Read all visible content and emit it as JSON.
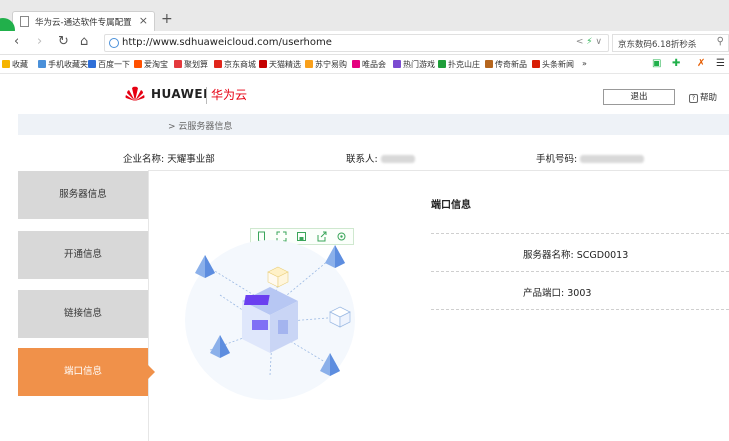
{
  "browser": {
    "tab_title": "华为云-通达软件专属配置",
    "tab_close": "×",
    "new_tab": "+",
    "url": "http://www.sdhuaweicloud.com/userhome",
    "search_text": "京东数码6.18折秒杀",
    "bookmarks": [
      {
        "label": "收藏",
        "color": "#f5b400"
      },
      {
        "label": "手机收藏夹",
        "color": "#4a90d9"
      },
      {
        "label": "百度一下",
        "color": "#2e6fd8"
      },
      {
        "label": "爱淘宝",
        "color": "#ff5000"
      },
      {
        "label": "聚划算",
        "color": "#e4393c"
      },
      {
        "label": "京东商城",
        "color": "#e1251b"
      },
      {
        "label": "天猫精选",
        "color": "#c40000"
      },
      {
        "label": "苏宁易购",
        "color": "#f9a01b"
      },
      {
        "label": "唯品会",
        "color": "#e5007f"
      },
      {
        "label": "热门游戏",
        "color": "#7b4bd1"
      },
      {
        "label": "扑克山庄",
        "color": "#1f9e3a"
      },
      {
        "label": "传奇新品",
        "color": "#b5651d"
      },
      {
        "label": "头条新闻",
        "color": "#d81e06"
      }
    ],
    "bookmarks_more": "»"
  },
  "header": {
    "logo_text": "HUAWEI",
    "logo_cn": "华为云",
    "logout_label": "退出",
    "help_label": "帮助",
    "brand_color": "#e60012"
  },
  "breadcrumb": "> 云服务器信息",
  "info": {
    "company_label": "企业名称:",
    "company_value": "天耀事业部",
    "contact_label": "联系人:",
    "phone_label": "手机号码:"
  },
  "sidebar": {
    "items": [
      {
        "label": "服务器信息",
        "active": false
      },
      {
        "label": "开通信息",
        "active": false
      },
      {
        "label": "链接信息",
        "active": false
      },
      {
        "label": "端口信息",
        "active": true
      }
    ],
    "active_color": "#f0914a"
  },
  "panel": {
    "title": "端口信息",
    "server_name_label": "服务器名称:",
    "server_name_value": "SCGD0013",
    "port_label": "产品端口:",
    "port_value": "3003"
  }
}
